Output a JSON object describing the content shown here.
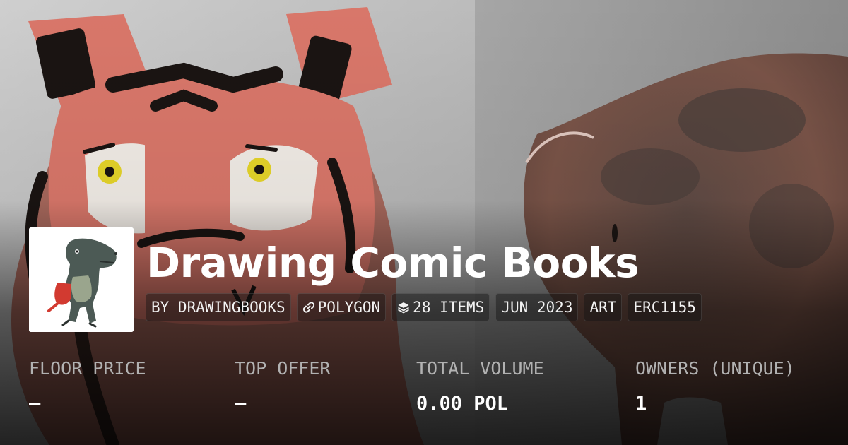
{
  "collection": {
    "title": "Drawing Comic Books"
  },
  "chips": {
    "creator": "BY DRAWINGBOOKS",
    "chain": "POLYGON",
    "items": "28 ITEMS",
    "date": "JUN 2023",
    "category": "ART",
    "standard": "ERC1155",
    "chain_icon": "link-icon",
    "items_icon": "layers-icon"
  },
  "stats": {
    "floor_label": "FLOOR PRICE",
    "floor_value": "–",
    "offer_label": "TOP OFFER",
    "offer_value": "–",
    "volume_label": "TOTAL VOLUME",
    "volume_value": "0.00 POL",
    "owners_label": "OWNERS (UNIQUE)",
    "owners_value": "1"
  },
  "colors": {
    "text": "#ffffff",
    "muted": "#b2b2b2",
    "tiger_orange": "#d9776a",
    "pig_brown": "#6d4a3f"
  }
}
